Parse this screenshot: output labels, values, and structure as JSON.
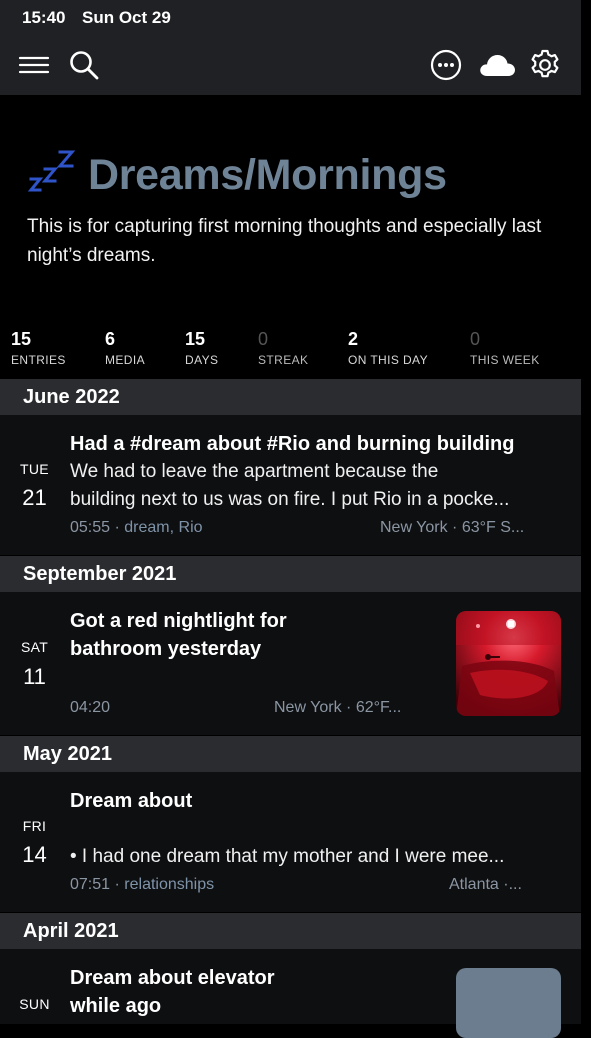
{
  "status": {
    "time": "15:40",
    "date": "Sun Oct 29"
  },
  "toolbar": {
    "icons": [
      "hamburger-menu-icon",
      "search-icon",
      "more-options-icon",
      "cloud-sync-icon",
      "settings-gear-icon"
    ]
  },
  "journal": {
    "title": "Dreams/Mornings",
    "description": "This is for capturing first morning thoughts and especially last night’s dreams.",
    "accent_color": "#6f8397"
  },
  "stats": [
    {
      "value": "15",
      "label": "ENTRIES"
    },
    {
      "value": "6",
      "label": "MEDIA"
    },
    {
      "value": "15",
      "label": "DAYS"
    },
    {
      "value": "0",
      "label": "STREAK"
    },
    {
      "value": "2",
      "label": "ON THIS DAY"
    },
    {
      "value": "0",
      "label": "THIS WEEK"
    }
  ],
  "sections": [
    {
      "month": "June 2022",
      "entries": [
        {
          "dow": "TUE",
          "day": "21",
          "title": "Had a #dream about #Rio and burning building",
          "body": [
            "We had to leave the apartment because the",
            "building next to us was on fire. I put Rio in a pocke..."
          ],
          "time": "05:55",
          "tags": "dream, Rio",
          "location": "New York · 63°F S..."
        }
      ]
    },
    {
      "month": "September 2021",
      "entries": [
        {
          "dow": "SAT",
          "day": "11",
          "title": [
            "Got a red nightlight for",
            "bathroom yesterday"
          ],
          "time": "04:20",
          "location": "New York · 62°F..."
        }
      ]
    },
    {
      "month": "May 2021",
      "entries": [
        {
          "dow": "FRI",
          "day": "14",
          "title": "Dream about",
          "body": [
            "• I had one dream that my mother and I were mee..."
          ],
          "time": "07:51",
          "tags": "relationships",
          "location": "Atlanta ·..."
        }
      ]
    },
    {
      "month": "April 2021",
      "entries": [
        {
          "dow": "SUN",
          "title": [
            "Dream about elevator",
            "while ago"
          ]
        }
      ]
    }
  ]
}
